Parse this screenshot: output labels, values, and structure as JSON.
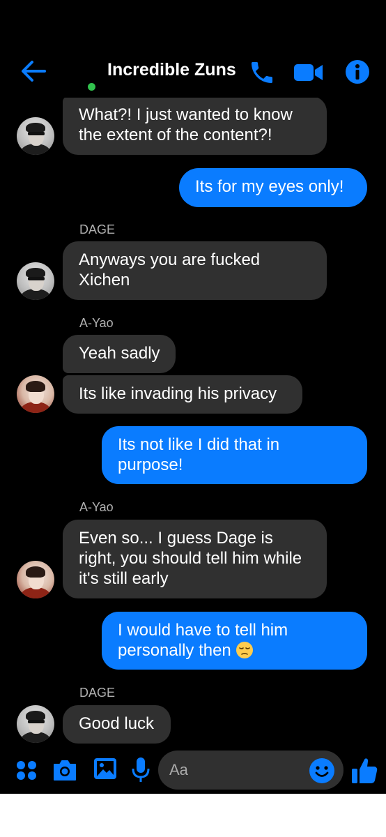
{
  "colors": {
    "background": "#000000",
    "accent": "#0a7cff",
    "incoming_bubble": "#303030",
    "presence": "#31c24d",
    "sender_label": "#b0b0b0"
  },
  "header": {
    "title": "Incredible Zuns",
    "back_icon": "arrow-left-icon",
    "call_icon": "phone-icon",
    "video_icon": "video-camera-icon",
    "info_icon": "info-icon",
    "online": true
  },
  "messages": [
    {
      "direction": "incoming",
      "sender_label": "",
      "avatar": "dage",
      "text": "What?! I just wanted to know\nthe extent of the content?!"
    },
    {
      "direction": "outgoing",
      "text": "Its for my eyes only!"
    },
    {
      "direction": "incoming",
      "sender_label": "DAGE",
      "avatar": "dage",
      "text": "Anyways you are fucked\nXichen"
    },
    {
      "direction": "incoming",
      "sender_label": "A-Yao",
      "avatar": "",
      "text": "Yeah sadly"
    },
    {
      "direction": "incoming",
      "sender_label": "",
      "avatar": "ayao",
      "text": "Its like invading his privacy"
    },
    {
      "direction": "outgoing",
      "text": "Its not like I did that in\npurpose!"
    },
    {
      "direction": "incoming",
      "sender_label": "A-Yao",
      "avatar": "ayao",
      "text": "Even so... I guess Dage is\nright, you should tell him while\nit's still early"
    },
    {
      "direction": "outgoing",
      "text": "I would have to tell him\npersonally then",
      "emoji": "pensive-face"
    },
    {
      "direction": "incoming",
      "sender_label": "DAGE",
      "avatar": "dage",
      "text": "Good luck"
    }
  ],
  "composer": {
    "placeholder": "Aa",
    "icons": [
      "menu-dots-icon",
      "camera-icon",
      "image-icon",
      "microphone-icon",
      "emoji-icon",
      "thumbs-up-icon"
    ]
  }
}
